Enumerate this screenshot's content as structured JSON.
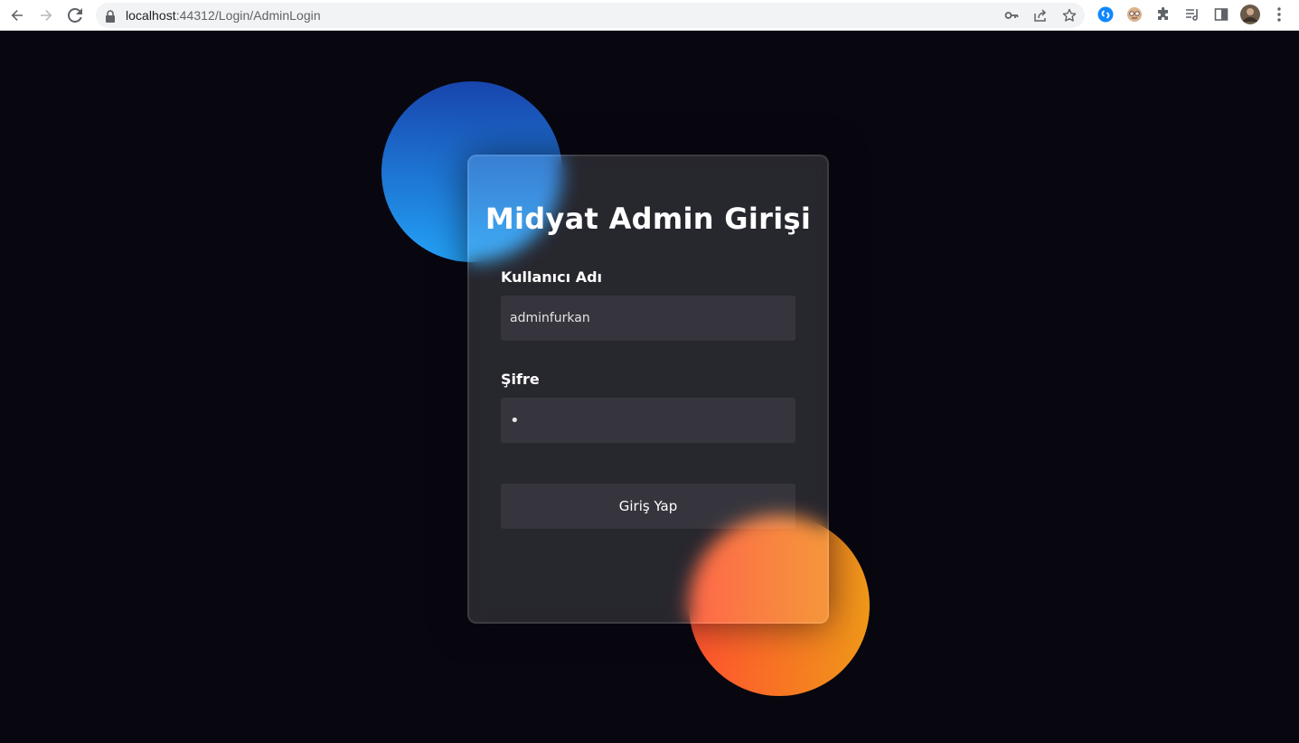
{
  "browser": {
    "url_host": "localhost",
    "url_path": ":44312/Login/AdminLogin"
  },
  "login": {
    "title": "Midyat Admin Girişi",
    "username_label": "Kullanıcı Adı",
    "username_value": "adminfurkan",
    "password_label": "Şifre",
    "password_value": "•",
    "submit_label": "Giriş Yap"
  },
  "colors": {
    "background": "#080710",
    "shape_blue_start": "#1845ad",
    "shape_blue_end": "#23a2f6",
    "shape_orange_start": "#ff512f",
    "shape_orange_end": "#f09819"
  }
}
